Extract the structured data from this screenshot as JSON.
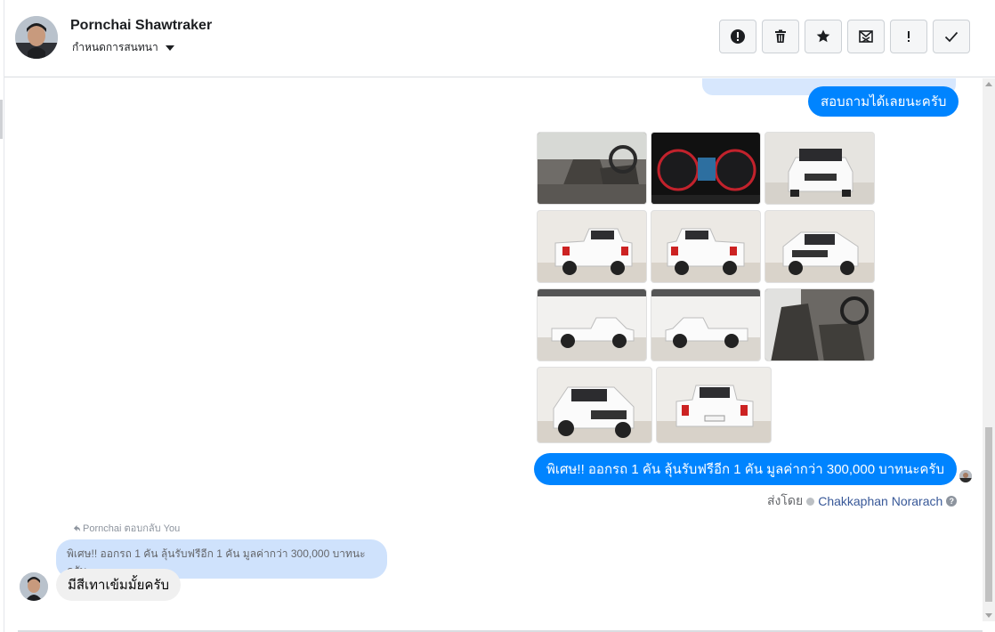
{
  "header": {
    "contact_name": "Pornchai Shawtraker",
    "conversation_setting": "กำหนดการสนทนา"
  },
  "toolbar": {
    "buttons": [
      "alert-circle-icon",
      "trash-icon",
      "star-icon",
      "mail-x-icon",
      "exclamation-icon",
      "check-icon"
    ]
  },
  "thread": {
    "messages_out": {
      "ask_text": "สอบถามได้เลยนะครับ",
      "promo_text": "พิเศษ!! ออกรถ 1 คัน ลุ้นรับฟรีอีก 1 คัน มูลค่ากว่า 300,000 บาทนะครับ"
    },
    "photos": [
      {
        "subject": "interior-seat"
      },
      {
        "subject": "dashboard-gauges"
      },
      {
        "subject": "truck-front"
      },
      {
        "subject": "truck-rear-left"
      },
      {
        "subject": "truck-rear-right"
      },
      {
        "subject": "truck-front-angle"
      },
      {
        "subject": "truck-side-left"
      },
      {
        "subject": "truck-side-right"
      },
      {
        "subject": "interior-seat-2"
      },
      {
        "subject": "truck-front-2"
      },
      {
        "subject": "truck-rear-2"
      }
    ],
    "sent_by_label": "ส่งโดย",
    "sent_by_name": "Chakkaphan Norarach",
    "reply_meta": "Pornchai ตอบกลับ You",
    "quoted_text": "พิเศษ!! ออกรถ 1 คัน ลุ้นรับฟรีอีก 1 คัน มูลค่ากว่า 300,000 บาทนะครับ",
    "incoming_text": "มีสีเทาเข้มมั้ยครับ"
  },
  "colors": {
    "outgoing_bubble": "#0084ff",
    "quoted_bubble": "#cfe2fc",
    "incoming_bubble": "#f0f0f0",
    "sender_link": "#385898"
  }
}
